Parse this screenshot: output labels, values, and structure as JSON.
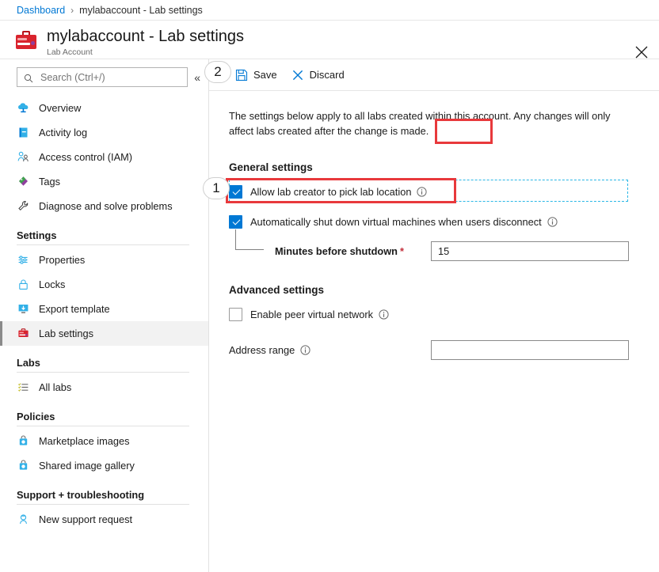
{
  "breadcrumb": {
    "root": "Dashboard",
    "separator": "›",
    "current": "mylabaccount - Lab settings"
  },
  "header": {
    "title": "mylabaccount - Lab settings",
    "subtitle": "Lab Account",
    "icon": "toolbox-icon",
    "close_icon": "close-icon"
  },
  "sidebar": {
    "search": {
      "placeholder": "Search (Ctrl+/)",
      "value": "",
      "icon": "search-icon"
    },
    "collapse_icon": "«",
    "items": [
      {
        "label": "Overview",
        "icon": "cloud-icon",
        "selected": false
      },
      {
        "label": "Activity log",
        "icon": "log-book-icon",
        "selected": false
      },
      {
        "label": "Access control (IAM)",
        "icon": "people-icon",
        "selected": false
      },
      {
        "label": "Tags",
        "icon": "tag-icon",
        "selected": false
      },
      {
        "label": "Diagnose and solve problems",
        "icon": "wrench-icon",
        "selected": false
      }
    ],
    "groups": [
      {
        "title": "Settings",
        "items": [
          {
            "label": "Properties",
            "icon": "sliders-icon",
            "selected": false
          },
          {
            "label": "Locks",
            "icon": "lock-icon",
            "selected": false
          },
          {
            "label": "Export template",
            "icon": "export-template-icon",
            "selected": false
          },
          {
            "label": "Lab settings",
            "icon": "toolbox-icon",
            "selected": true
          }
        ]
      },
      {
        "title": "Labs",
        "items": [
          {
            "label": "All labs",
            "icon": "checklist-icon",
            "selected": false
          }
        ]
      },
      {
        "title": "Policies",
        "items": [
          {
            "label": "Marketplace images",
            "icon": "marketplace-icon",
            "selected": false
          },
          {
            "label": "Shared image gallery",
            "icon": "gallery-icon",
            "selected": false
          }
        ]
      },
      {
        "title": "Support + troubleshooting",
        "items": [
          {
            "label": "New support request",
            "icon": "support-person-icon",
            "selected": false
          }
        ]
      }
    ]
  },
  "command_bar": {
    "save": {
      "label": "Save",
      "icon": "save-disk-icon"
    },
    "discard": {
      "label": "Discard",
      "icon": "close-x-icon"
    }
  },
  "main": {
    "intro": "The settings below apply to all labs created within this account. Any changes will only affect labs created after the change is made.",
    "general_settings": {
      "title": "General settings",
      "allow_location": {
        "label": "Allow lab creator to pick lab location",
        "checked": true,
        "info_icon": "info-icon"
      },
      "auto_shutdown": {
        "label": "Automatically shut down virtual machines when users disconnect",
        "checked": true,
        "info_icon": "info-icon"
      },
      "minutes_before_shutdown": {
        "label": "Minutes before shutdown",
        "required_marker": "*",
        "value": "15",
        "placeholder": ""
      }
    },
    "advanced_settings": {
      "title": "Advanced settings",
      "enable_peer_vnet": {
        "label": "Enable peer virtual network",
        "checked": false,
        "info_icon": "info-icon"
      },
      "address_range": {
        "label": "Address range",
        "value": "",
        "placeholder": "",
        "info_icon": "info-icon"
      }
    }
  },
  "annotations": {
    "badges": [
      {
        "number": "1",
        "target": "allow-lab-creator-checkbox"
      },
      {
        "number": "2",
        "target": "save-button"
      }
    ],
    "highlight_color": "#e8393c",
    "focus_outline_color": "#2ab7e6"
  },
  "colors": {
    "accent": "#0078d4",
    "link": "#0078d4",
    "highlight": "#e8393c",
    "required": "#c32e3a",
    "selected_bg": "#f2f2f2"
  }
}
